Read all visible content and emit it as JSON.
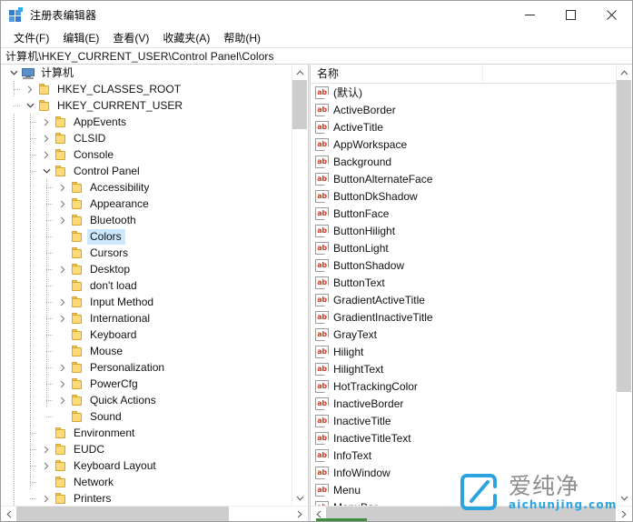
{
  "window": {
    "title": "注册表编辑器",
    "icon": "registry-editor-icon",
    "minimize_label": "–",
    "maximize_label": "□",
    "close_label": "✕"
  },
  "menubar": {
    "items": [
      {
        "label": "文件(F)"
      },
      {
        "label": "编辑(E)"
      },
      {
        "label": "查看(V)"
      },
      {
        "label": "收藏夹(A)"
      },
      {
        "label": "帮助(H)"
      }
    ]
  },
  "address": {
    "path": "计算机\\HKEY_CURRENT_USER\\Control Panel\\Colors"
  },
  "tree": {
    "nodes": [
      {
        "label": "计算机",
        "depth": 0,
        "expander": "expanded",
        "icon": "computer-icon"
      },
      {
        "label": "HKEY_CLASSES_ROOT",
        "depth": 1,
        "expander": "collapsed",
        "icon": "folder-icon"
      },
      {
        "label": "HKEY_CURRENT_USER",
        "depth": 1,
        "expander": "expanded",
        "icon": "folder-icon"
      },
      {
        "label": "AppEvents",
        "depth": 2,
        "expander": "collapsed",
        "icon": "folder-icon"
      },
      {
        "label": "CLSID",
        "depth": 2,
        "expander": "collapsed",
        "icon": "folder-icon"
      },
      {
        "label": "Console",
        "depth": 2,
        "expander": "collapsed",
        "icon": "folder-icon"
      },
      {
        "label": "Control Panel",
        "depth": 2,
        "expander": "expanded",
        "icon": "folder-icon"
      },
      {
        "label": "Accessibility",
        "depth": 3,
        "expander": "collapsed",
        "icon": "folder-icon"
      },
      {
        "label": "Appearance",
        "depth": 3,
        "expander": "collapsed",
        "icon": "folder-icon"
      },
      {
        "label": "Bluetooth",
        "depth": 3,
        "expander": "collapsed",
        "icon": "folder-icon"
      },
      {
        "label": "Colors",
        "depth": 3,
        "expander": "leaf",
        "icon": "folder-icon",
        "selected": true
      },
      {
        "label": "Cursors",
        "depth": 3,
        "expander": "leaf",
        "icon": "folder-icon"
      },
      {
        "label": "Desktop",
        "depth": 3,
        "expander": "collapsed",
        "icon": "folder-icon"
      },
      {
        "label": "don't load",
        "depth": 3,
        "expander": "leaf",
        "icon": "folder-icon"
      },
      {
        "label": "Input Method",
        "depth": 3,
        "expander": "collapsed",
        "icon": "folder-icon"
      },
      {
        "label": "International",
        "depth": 3,
        "expander": "collapsed",
        "icon": "folder-icon"
      },
      {
        "label": "Keyboard",
        "depth": 3,
        "expander": "leaf",
        "icon": "folder-icon"
      },
      {
        "label": "Mouse",
        "depth": 3,
        "expander": "leaf",
        "icon": "folder-icon"
      },
      {
        "label": "Personalization",
        "depth": 3,
        "expander": "collapsed",
        "icon": "folder-icon"
      },
      {
        "label": "PowerCfg",
        "depth": 3,
        "expander": "collapsed",
        "icon": "folder-icon"
      },
      {
        "label": "Quick Actions",
        "depth": 3,
        "expander": "collapsed",
        "icon": "folder-icon"
      },
      {
        "label": "Sound",
        "depth": 3,
        "expander": "leaf",
        "icon": "folder-icon"
      },
      {
        "label": "Environment",
        "depth": 2,
        "expander": "leaf",
        "icon": "folder-icon"
      },
      {
        "label": "EUDC",
        "depth": 2,
        "expander": "collapsed",
        "icon": "folder-icon"
      },
      {
        "label": "Keyboard Layout",
        "depth": 2,
        "expander": "collapsed",
        "icon": "folder-icon"
      },
      {
        "label": "Network",
        "depth": 2,
        "expander": "leaf",
        "icon": "folder-icon"
      },
      {
        "label": "Printers",
        "depth": 2,
        "expander": "collapsed",
        "icon": "folder-icon"
      }
    ]
  },
  "values": {
    "columns": [
      {
        "label": "名称"
      }
    ],
    "rows": [
      {
        "name": "(默认)",
        "icon": "string-value-icon"
      },
      {
        "name": "ActiveBorder",
        "icon": "string-value-icon"
      },
      {
        "name": "ActiveTitle",
        "icon": "string-value-icon"
      },
      {
        "name": "AppWorkspace",
        "icon": "string-value-icon"
      },
      {
        "name": "Background",
        "icon": "string-value-icon"
      },
      {
        "name": "ButtonAlternateFace",
        "icon": "string-value-icon"
      },
      {
        "name": "ButtonDkShadow",
        "icon": "string-value-icon"
      },
      {
        "name": "ButtonFace",
        "icon": "string-value-icon"
      },
      {
        "name": "ButtonHilight",
        "icon": "string-value-icon"
      },
      {
        "name": "ButtonLight",
        "icon": "string-value-icon"
      },
      {
        "name": "ButtonShadow",
        "icon": "string-value-icon"
      },
      {
        "name": "ButtonText",
        "icon": "string-value-icon"
      },
      {
        "name": "GradientActiveTitle",
        "icon": "string-value-icon"
      },
      {
        "name": "GradientInactiveTitle",
        "icon": "string-value-icon"
      },
      {
        "name": "GrayText",
        "icon": "string-value-icon"
      },
      {
        "name": "Hilight",
        "icon": "string-value-icon"
      },
      {
        "name": "HilightText",
        "icon": "string-value-icon"
      },
      {
        "name": "HotTrackingColor",
        "icon": "string-value-icon"
      },
      {
        "name": "InactiveBorder",
        "icon": "string-value-icon"
      },
      {
        "name": "InactiveTitle",
        "icon": "string-value-icon"
      },
      {
        "name": "InactiveTitleText",
        "icon": "string-value-icon"
      },
      {
        "name": "InfoText",
        "icon": "string-value-icon"
      },
      {
        "name": "InfoWindow",
        "icon": "string-value-icon"
      },
      {
        "name": "Menu",
        "icon": "string-value-icon"
      },
      {
        "name": "MenuBar",
        "icon": "string-value-icon"
      }
    ]
  },
  "scrollbars": {
    "tree_vertical": {
      "thumb_top_pct": 0,
      "thumb_height_pct": 12
    },
    "tree_horizontal": {
      "thumb_left_pct": 0,
      "thumb_width_pct": 77
    },
    "list_vertical": {
      "thumb_top_pct": 0,
      "thumb_height_pct": 76
    },
    "list_horizontal": {
      "thumb_left_pct": 0,
      "thumb_width_pct": 100
    }
  },
  "watermark": {
    "cn": "爱纯净",
    "en": "aichunjing.com",
    "logo_color": "#2aa3e0"
  }
}
